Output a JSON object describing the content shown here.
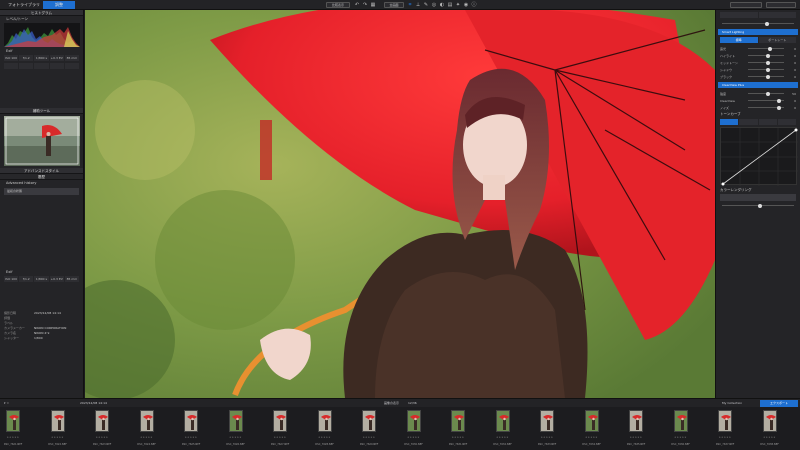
{
  "topbar": {
    "library_tab": "フォトライブラリ",
    "edit_tab": "調整",
    "compare_button": "比較表示",
    "fit_button": "全画面",
    "zoom_label": "",
    "right_tabs": [
      "",
      ""
    ]
  },
  "left": {
    "histogram_title": "ヒストグラム",
    "levels_label": "レベル/トーン",
    "mode_label": "RGB",
    "exif_title": "Exif",
    "exif_cells_row1": [
      "ISO 100",
      "f/1.2",
      "1/800 s",
      "+0.3 EV",
      "85 mm"
    ],
    "exif_cells_row2": [
      "",
      "",
      "",
      "",
      ""
    ],
    "navigator_title": "補助ツール",
    "history_title": "アドバンスドスタイル",
    "history_sub": "履歴",
    "history_item": "Advanced history",
    "history_button": "最初の状態",
    "metadata_title": "Exif",
    "metadata": [
      {
        "k": "撮影日時",
        "v": "2023/12/08 14:14"
      },
      {
        "k": "評価",
        "v": ""
      },
      {
        "k": "ラベル",
        "v": ""
      },
      {
        "k": "カメラメーカー",
        "v": "NIKON CORPORATION"
      },
      {
        "k": "カメラ名",
        "v": "NIKON Z 9"
      },
      {
        "k": "シャッター",
        "v": "1/800"
      }
    ]
  },
  "right": {
    "section1": "Smart Lighting",
    "seg1": [
      "標準",
      "ポートレート"
    ],
    "section2": "ClearView Plus",
    "tone_label": "トーンカーブ",
    "sliders": [
      {
        "label": "露光",
        "val": "0"
      },
      {
        "label": "ハイライト",
        "val": "0"
      },
      {
        "label": "ミッドトーン",
        "val": "0"
      },
      {
        "label": "シャドウ",
        "val": "0"
      },
      {
        "label": "ブラック",
        "val": "0"
      }
    ],
    "sliders2": [
      {
        "label": "強度",
        "val": "50"
      },
      {
        "label": "ClearView",
        "val": "0"
      },
      {
        "label": "ノイズ",
        "val": "0"
      }
    ],
    "bottom_label": "カラーレンダリング"
  },
  "filmbar": {
    "left_text": "2023/12/08 14:14",
    "mid_text": "画像の表示",
    "count": "12/36",
    "right_text": "My Collection",
    "export_label": "エクスポート"
  },
  "film_labels": [
    "DSC_7621.NEF",
    "DSC_7622.NEF",
    "DSC_7623.NEF",
    "DSC_7624.NEF",
    "DSC_7625.NEF",
    "DSC_7626.NEF",
    "DSC_7627.NEF",
    "DSC_7628.NEF",
    "DSC_7629.NEF",
    "DSC_7630.NEF",
    "DSC_7631.NEF",
    "DSC_7632.NEF",
    "DSC_7633.NEF",
    "DSC_7634.NEF",
    "DSC_7635.NEF",
    "DSC_7636.NEF",
    "DSC_7637.NEF",
    "DSC_7638.NEF"
  ],
  "colors": {
    "accent": "#1e6fd0",
    "umbrella": "#e8242a",
    "background_green": "#7e9a4a"
  }
}
